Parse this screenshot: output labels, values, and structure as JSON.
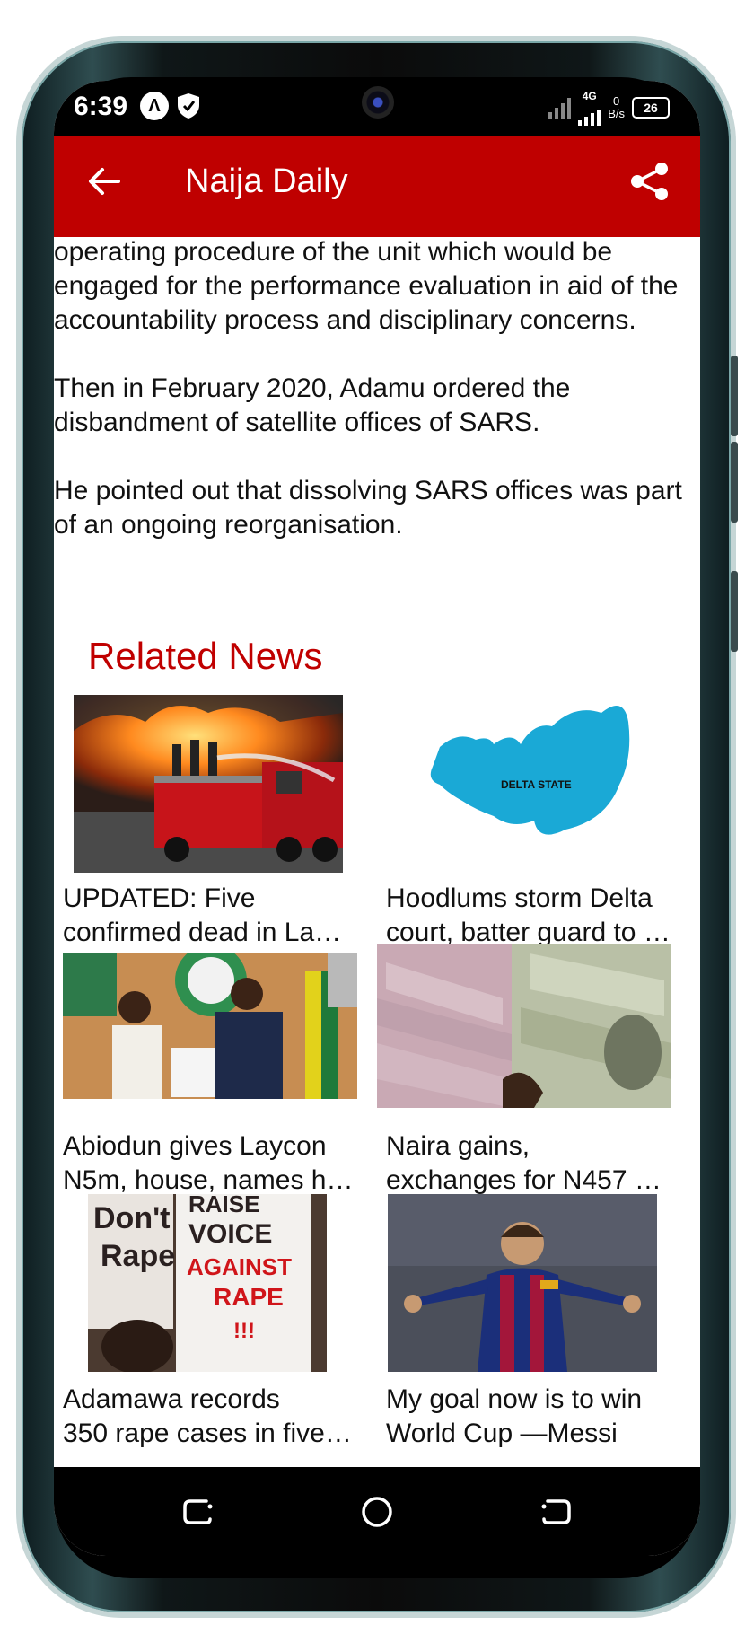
{
  "status": {
    "time": "6:39",
    "network": "4G",
    "speed_value": "0",
    "speed_unit": "B/s",
    "battery": "26"
  },
  "app": {
    "title": "Naija Daily"
  },
  "article": {
    "paragraphs": [
      "operating procedure of the unit which would be engaged for the performance evaluation in aid of the accountability process and disciplinary concerns.",
      "Then in February 2020, Adamu ordered the disbandment of satellite offices of SARS.",
      "He pointed out that dissolving SARS offices was part of an ongoing reorganisation."
    ]
  },
  "related": {
    "heading": "Related News",
    "items": [
      {
        "line1": "UPDATED: Five",
        "line2": "confirmed dead in La…",
        "image": "fire-truck-photo"
      },
      {
        "line1": "Hoodlums storm Delta",
        "line2": "court, batter guard to …",
        "image": "delta-state-map",
        "map_label": "DELTA STATE"
      },
      {
        "line1": "Abiodun gives Laycon",
        "line2": "N5m, house, names h…",
        "image": "elbow-greeting-photo"
      },
      {
        "line1": "Naira gains,",
        "line2": "exchanges for N457 …",
        "image": "currency-notes-photo"
      },
      {
        "line1": "Adamawa records",
        "line2": "350 rape cases in five…",
        "image": "protest-placards-photo",
        "placard_left": "Don't Rape",
        "placard_right": "RAISE VOICE AGAINST RAPE !!!"
      },
      {
        "line1": "My goal now is to win",
        "line2": "World Cup —Messi",
        "image": "footballer-photo"
      }
    ]
  },
  "colors": {
    "app_bar": "#bf0000",
    "heading": "#c00000",
    "map_fill": "#1aa9d6"
  }
}
